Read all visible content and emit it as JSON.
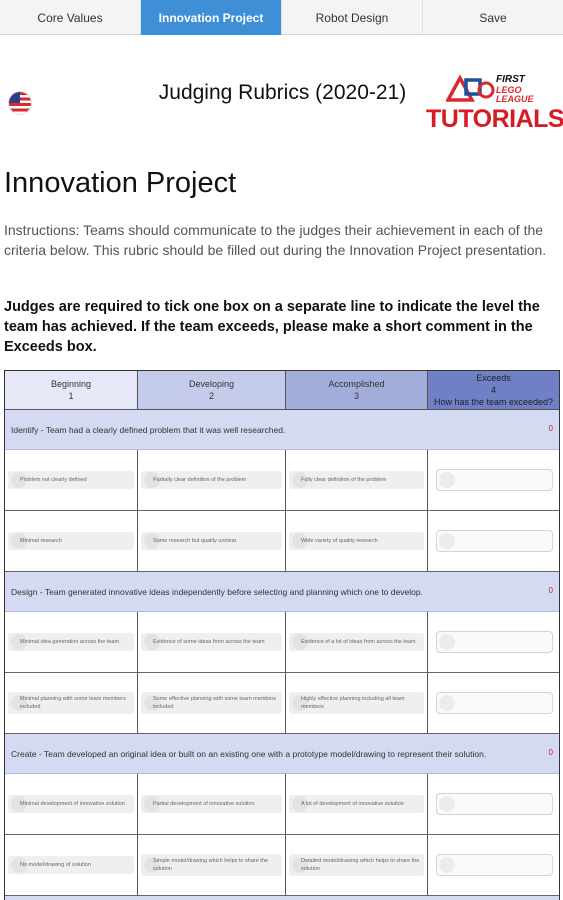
{
  "tabs": [
    {
      "label": "Core Values"
    },
    {
      "label": "Innovation Project"
    },
    {
      "label": "Robot Design"
    },
    {
      "label": "Save"
    }
  ],
  "header": {
    "flag_icon": "us-flag-icon",
    "title": "Judging Rubrics (2020-21)",
    "logo": {
      "first": "FIRST",
      "lego_league": "LEGO LEAGUE",
      "tutorials": "TUTORIALS"
    }
  },
  "page_title": "Innovation Project",
  "instructions": "Instructions: Teams should communicate to the judges their achievement in each of the criteria below. This rubric should be filled out during the Innovation Project presentation.",
  "judges_note": "Judges are required to tick one box on a separate line to indicate the level the team has achieved. If the team exceeds, please make a short comment in the Exceeds box.",
  "columns": [
    {
      "label": "Beginning",
      "num": "1"
    },
    {
      "label": "Developing",
      "num": "2"
    },
    {
      "label": "Accomplished",
      "num": "3"
    },
    {
      "label": "Exceeds",
      "num": "4",
      "extra": "How has the team exceeded?"
    }
  ],
  "sections": [
    {
      "title": "Identify - Team had a clearly defined problem that it was well researched.",
      "score": "0",
      "rows": [
        [
          "Problem not clearly defined",
          "Partially clear definition of the problem",
          "Fully clear definition of the problem"
        ],
        [
          "Minimal research",
          "Some research but quality unclear",
          "Wide variety of quality research"
        ]
      ]
    },
    {
      "title": "Design - Team generated innovative ideas independently before selecting and planning which one to develop.",
      "score": "0",
      "rows": [
        [
          "Minimal idea generation across the team",
          "Evidence of some ideas from across the team",
          "Evidence of a lot of ideas from across the team"
        ],
        [
          "Minimal planning with some team members included",
          "Some effective planning with some team members included",
          "Highly effective planning including all team members"
        ]
      ]
    },
    {
      "title": "Create - Team developed an original idea or built on an existing one with a prototype model/drawing to represent their solution.",
      "score": "0",
      "rows": [
        [
          "Minimal development of innovative solution",
          "Partial development of innovative solution",
          "A lot of development of innovative solution"
        ],
        [
          "No model/drawing of solution",
          "Simple model/drawing which helps to share the solution",
          "Detailed model/drawing which helps to share the solution"
        ]
      ]
    }
  ]
}
